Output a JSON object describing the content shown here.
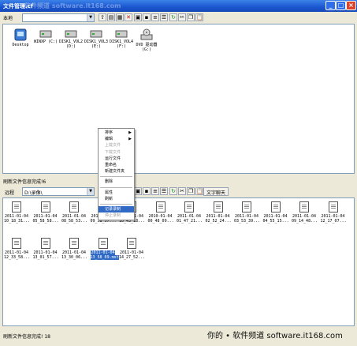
{
  "window": {
    "title": "文件管理.cf",
    "watermark_top": "·软件频道 software.it168.com",
    "controls": {
      "minimize": "_",
      "maximize": "□",
      "close": "×"
    }
  },
  "local_pane": {
    "label": "本地",
    "drive_combo": "",
    "drives": [
      {
        "label": "Desktop",
        "icon": "desktop-icon"
      },
      {
        "label": "WINXP (C:)",
        "icon": "hard-drive-icon"
      },
      {
        "label": "DISK1_VOL2 (D:)",
        "icon": "hard-drive-icon"
      },
      {
        "label": "DISK1_VOL3 (E:)",
        "icon": "hard-drive-icon"
      },
      {
        "label": "DISK1_VOL4 (F:)",
        "icon": "hard-drive-icon"
      },
      {
        "label": "DVD 驱动器 (G:)",
        "icon": "dvd-drive-icon"
      }
    ],
    "status": "刷新文件信息完成!6"
  },
  "remote_pane": {
    "label": "远程",
    "path_combo": "D:\\录像\\",
    "text_chat_button": "文字聊天",
    "files": [
      {
        "line1": "2011-01-04",
        "line2": "10_18_31..."
      },
      {
        "line1": "2011-01-04",
        "line2": "05_58_58..."
      },
      {
        "line1": "2011-01-04",
        "line2": "08_58_53..."
      },
      {
        "line1": "2011-01-04",
        "line2": "09_58_57..."
      },
      {
        "line1": "2011-01-04",
        "line2": "10_43_18..."
      },
      {
        "line1": "2010-01-04",
        "line2": "00_48_09..."
      },
      {
        "line1": "2011-01-04",
        "line2": "01_47_21..."
      },
      {
        "line1": "2011-01-04",
        "line2": "02_52_24..."
      },
      {
        "line1": "2011-01-04",
        "line2": "03_53_39..."
      },
      {
        "line1": "2011-01-04",
        "line2": "04_55_15..."
      },
      {
        "line1": "2011-01-04",
        "line2": "09_14_48..."
      },
      {
        "line1": "2011-01-04",
        "line2": "12_17_07..."
      },
      {
        "line1": "2011-01-04",
        "line2": "12_33_58..."
      },
      {
        "line1": "2011-01-04",
        "line2": "13_01_57..."
      },
      {
        "line1": "2011-01-04",
        "line2": "13_30_06..."
      },
      {
        "line1": "2011-01-04",
        "line2": "13_58_09.mst",
        "selected": true
      },
      {
        "line1": "2011-01-04",
        "line2": "14_27_52..."
      }
    ],
    "status": "刷新文件信息完成! 18"
  },
  "context_menu": {
    "items": [
      {
        "label": "排序",
        "submenu": true
      },
      {
        "label": "编辑",
        "submenu": true
      },
      {
        "label": "上载文件",
        "disabled": true
      },
      {
        "label": "下载文件",
        "disabled": true
      },
      {
        "label": "运行文件"
      },
      {
        "label": "重命名"
      },
      {
        "label": "新建文件夹"
      },
      {
        "sep": true
      },
      {
        "label": "删除"
      },
      {
        "sep": true
      },
      {
        "label": "属性"
      },
      {
        "label": "刷新"
      },
      {
        "sep": true
      },
      {
        "label": "记录录制",
        "highlighted": true
      },
      {
        "label": "停止录制",
        "disabled": true
      }
    ]
  },
  "watermark": "你的 • 软件频道 software.it168.com",
  "colors": {
    "accent": "#316ac5",
    "titlebar": "#1a56d0",
    "frame": "#ece9d8"
  }
}
